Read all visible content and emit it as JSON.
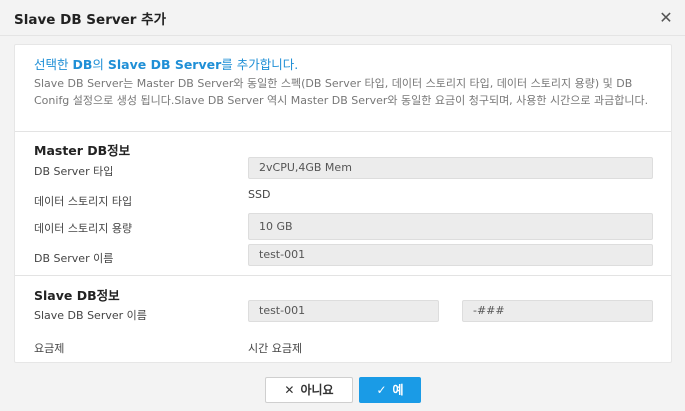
{
  "dialog": {
    "title": "Slave DB Server 추가",
    "close_icon": "close-icon"
  },
  "intro": {
    "title_prefix": "선택한 ",
    "title_db": "DB",
    "title_mid": "의 ",
    "title_slave": "Slave DB Server",
    "title_suffix": "를 추가합니다.",
    "description": "Slave DB Server는 Master DB Server와 동일한 스펙(DB Server 타입, 데이터 스토리지 타입, 데이터 스토리지 용량) 및 DB Conifg 설정으로 생성 됩니다.Slave DB Server 역시 Master DB Server와 동일한 요금이 청구되며, 사용한 시간으로 과금합니다."
  },
  "master": {
    "section_title": "Master DB정보",
    "server_type_label": "DB Server 타입",
    "server_type_value": "2vCPU,4GB Mem",
    "storage_type_label": "데이터 스토리지 타입",
    "storage_type_value": "SSD",
    "storage_size_label": "데이터 스토리지 용량",
    "storage_size_value": "10 GB",
    "server_name_label": "DB Server 이름",
    "server_name_value": "test-001"
  },
  "slave": {
    "section_title": "Slave DB정보",
    "server_name_label": "Slave DB Server 이름",
    "server_name_prefix": "test-001",
    "server_name_suffix": "-###",
    "pricing_label": "요금제",
    "pricing_value": "시간 요금제"
  },
  "footer": {
    "no_label": "아니요",
    "yes_label": "예",
    "no_icon": "x-icon",
    "yes_icon": "check-icon"
  },
  "colors": {
    "accent": "#1a9be6",
    "intro_title": "#1f8fd6"
  }
}
